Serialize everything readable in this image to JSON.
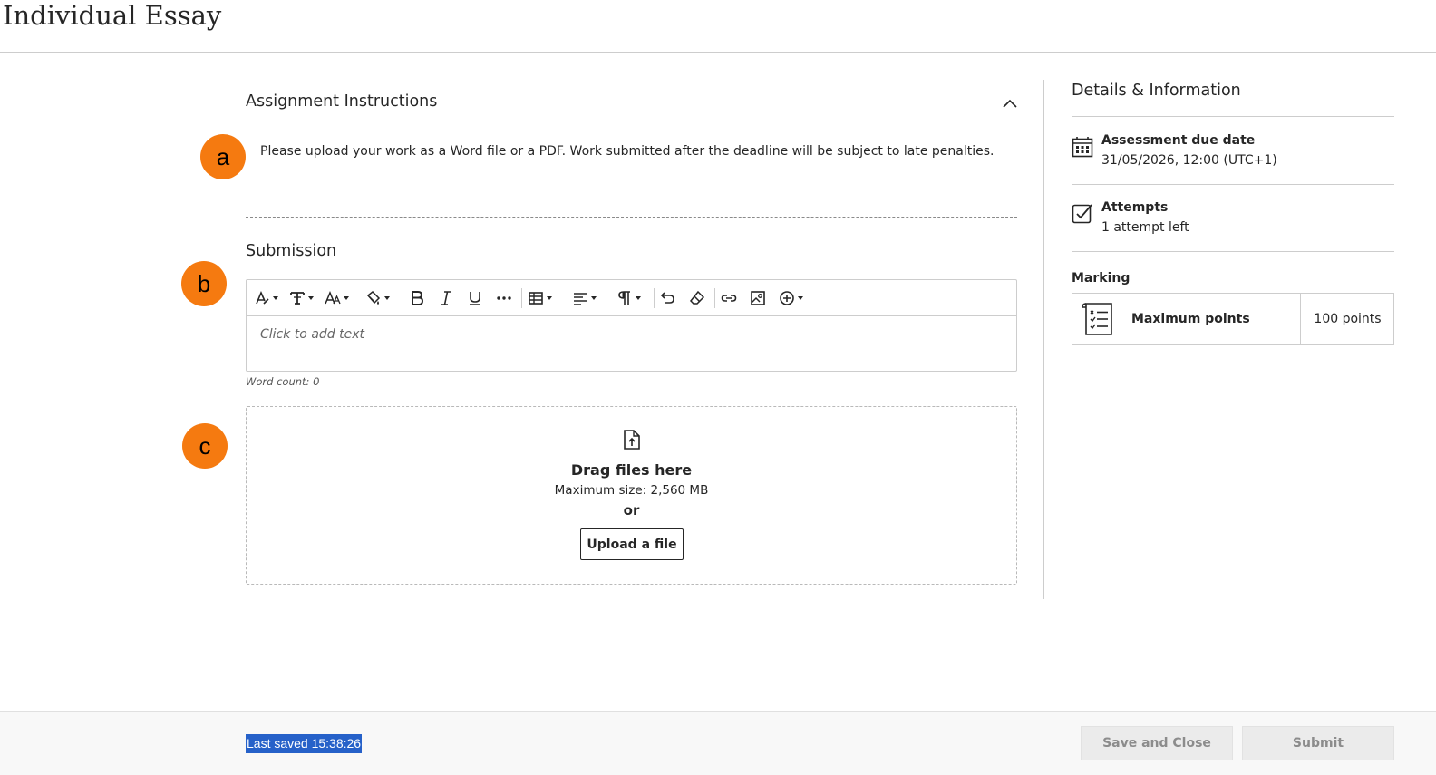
{
  "page": {
    "title": "Individual Essay"
  },
  "instructions": {
    "heading": "Assignment Instructions",
    "text": "Please upload your work as a Word file or a PDF. Work submitted after the deadline will be subject to late penalties."
  },
  "markers": {
    "a": "a",
    "b": "b",
    "c": "c"
  },
  "submission": {
    "heading": "Submission",
    "placeholder": "Click to add text",
    "word_count": "Word count: 0",
    "toolbar_icons": [
      "text-style-icon",
      "paragraph-format-icon",
      "font-size-icon",
      "highlight-color-icon",
      "bold-icon",
      "italic-icon",
      "underline-icon",
      "more-formatting-icon",
      "insert-table-icon",
      "align-icon",
      "paragraph-icon",
      "undo-icon",
      "clear-formatting-icon",
      "insert-link-icon",
      "insert-image-icon",
      "insert-content-icon"
    ]
  },
  "upload": {
    "title": "Drag files here",
    "max_size": "Maximum size: 2,560 MB",
    "or": "or",
    "button": "Upload a file"
  },
  "details": {
    "heading": "Details & Information",
    "due_date_label": "Assessment due date",
    "due_date_value": "31/05/2026, 12:00 (UTC+1)",
    "attempts_label": "Attempts",
    "attempts_value": "1 attempt left",
    "marking_label": "Marking",
    "max_points_label": "Maximum points",
    "max_points_value": "100 points"
  },
  "footer": {
    "last_saved": "Last saved 15:38:26",
    "save_close": "Save and Close",
    "submit": "Submit"
  },
  "colors": {
    "marker": "#f57a10",
    "saved_highlight": "#2661c9",
    "disabled_button": "#ebebeb"
  }
}
